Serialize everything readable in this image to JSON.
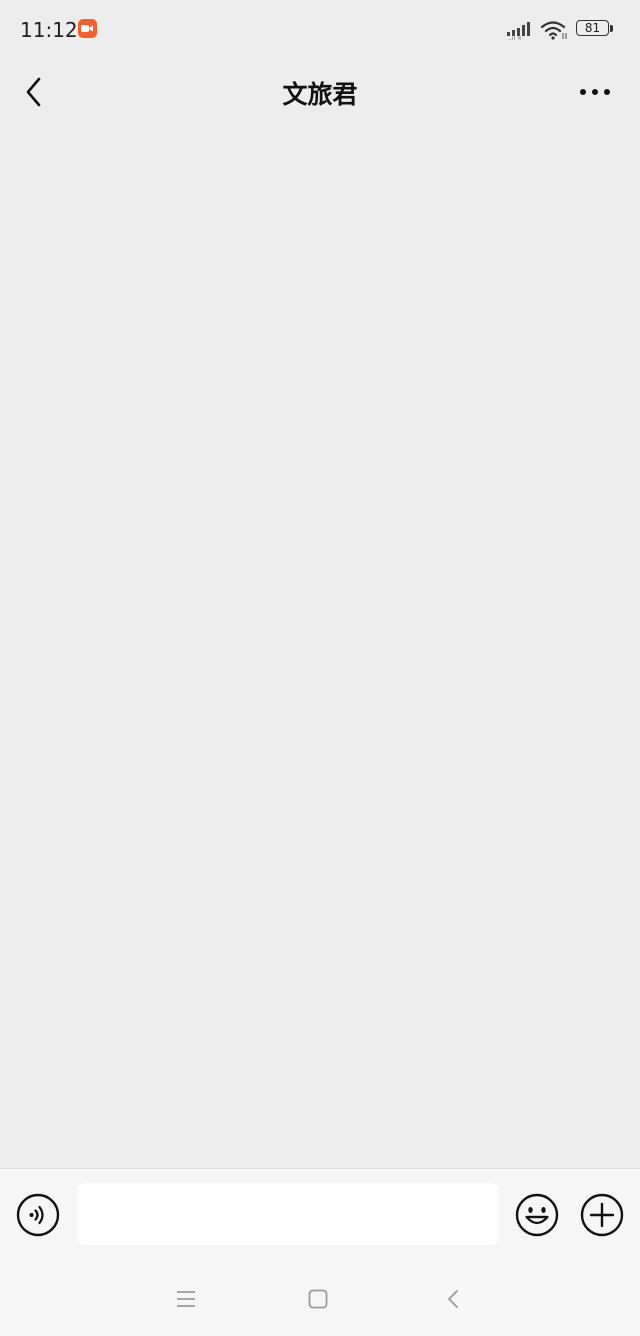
{
  "status_bar": {
    "time": "11:12",
    "battery_level": "81",
    "icons": [
      "screen-record-icon",
      "signal-icon",
      "wifi-icon",
      "battery-icon"
    ]
  },
  "header": {
    "title": "文旅君",
    "back_icon": "chevron-left-icon",
    "more_icon": "more-dots-icon"
  },
  "chat": {
    "messages": []
  },
  "input_bar": {
    "value": "",
    "placeholder": "",
    "icons": [
      "voice-icon",
      "emoji-icon",
      "plus-icon"
    ]
  },
  "system_nav": {
    "icons": [
      "menu-icon",
      "home-icon",
      "back-triangle-icon"
    ]
  },
  "colors": {
    "background": "#ededed",
    "input_bar_bg": "#f6f6f6",
    "record_badge": "#f4602d",
    "icon_stroke": "#111111"
  }
}
